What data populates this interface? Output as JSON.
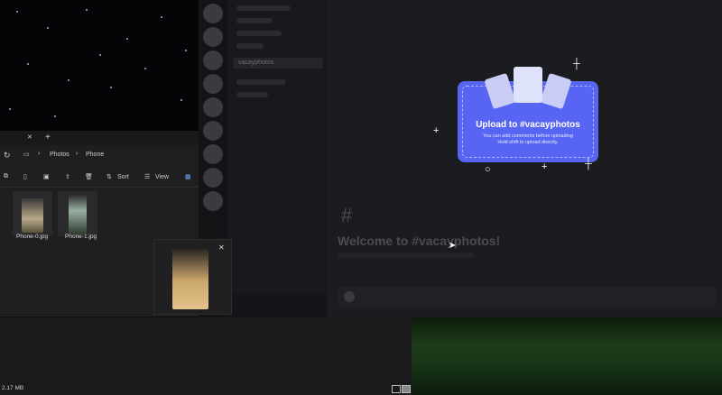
{
  "explorer": {
    "breadcrumb": [
      "Photos",
      "Phone"
    ],
    "toolbar": {
      "sort_label": "Sort",
      "view_label": "View"
    },
    "files": [
      {
        "name": "Phone-0.jpg"
      },
      {
        "name": "Phone-1.jpg"
      }
    ],
    "status_text": "2.17 MB"
  },
  "discord": {
    "channel_name": "vacayphotos",
    "welcome_text": "Welcome to #vacayphotos!",
    "hash_symbol": "#",
    "upload": {
      "title": "Upload to #vacayphotos",
      "line1": "You can add comments before uploading",
      "line2": "Hold shift to upload directly."
    }
  },
  "colors": {
    "upload_accent": "#5865f2",
    "discord_bg": "#1b1c1f",
    "explorer_bg": "#1f1f21"
  }
}
